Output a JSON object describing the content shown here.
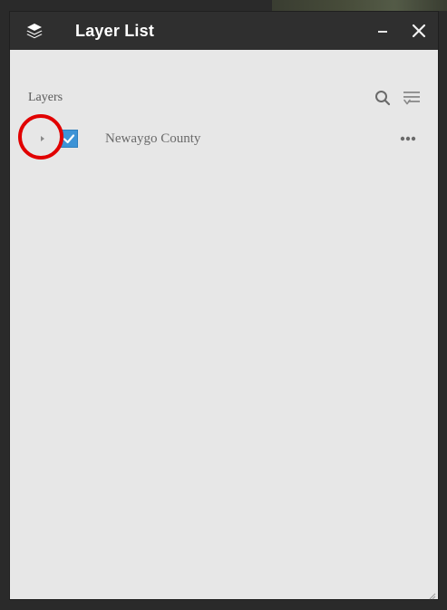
{
  "window": {
    "title": "Layer List",
    "icon": "layers-icon",
    "minimize_icon": "minimize-icon",
    "close_icon": "close-icon"
  },
  "panel": {
    "label": "Layers",
    "search_icon": "search-icon",
    "filter_icon": "filter-list-icon"
  },
  "layers": [
    {
      "name": "Newaygo County",
      "checked": true,
      "expanded": false,
      "expander_icon": "chevron-right-icon",
      "menu_icon": "more-options-icon"
    }
  ],
  "colors": {
    "titlebar": "#2f2f2f",
    "panel_bg": "#e7e7e7",
    "checkbox": "#3d93d6",
    "highlight": "#e10000"
  }
}
